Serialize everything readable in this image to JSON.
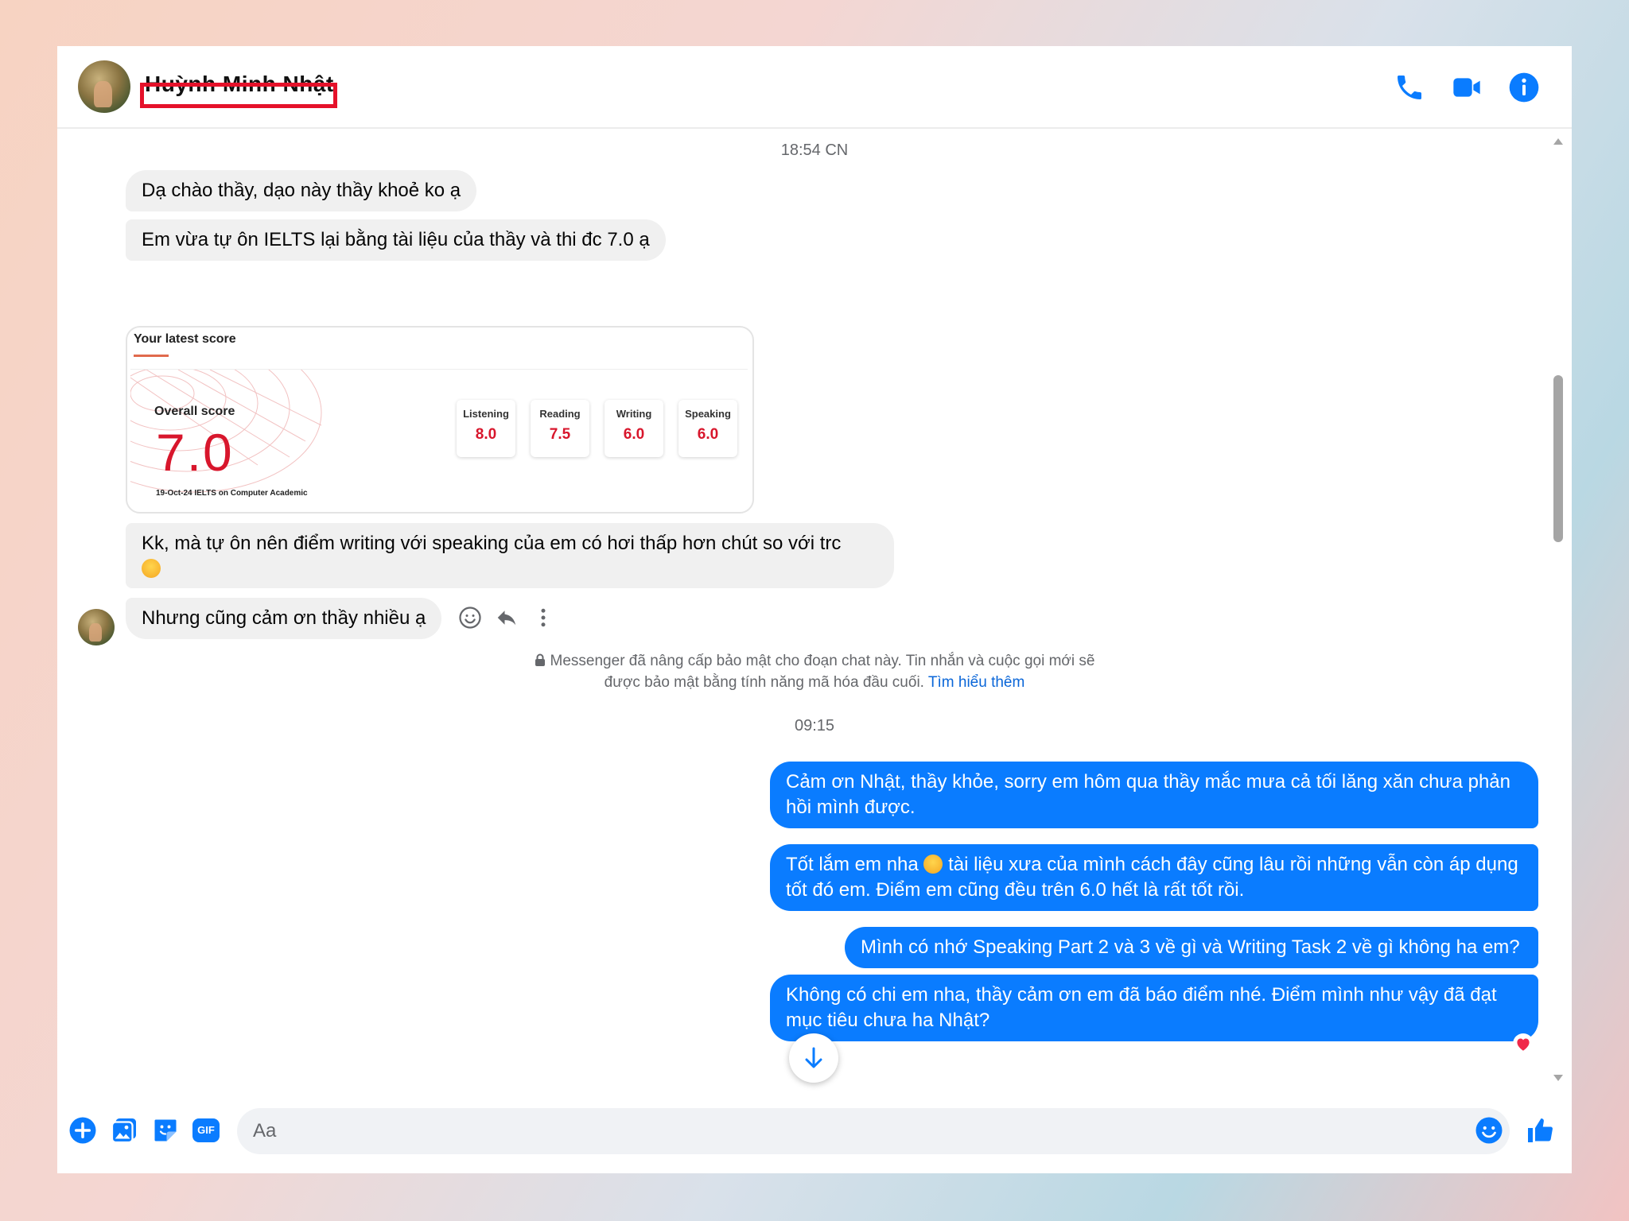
{
  "header": {
    "contact_name": "Huỳnh Minh Nhật",
    "icons": [
      "phone-icon",
      "video-call-icon",
      "info-icon"
    ]
  },
  "colors": {
    "accent": "#0a7cff",
    "incoming_bubble": "#f0f0f0",
    "score_red": "#d8162c",
    "redaction": "#e5112a"
  },
  "conversation": {
    "timestamp_1": "18:54 CN",
    "incoming": [
      "Dạ chào thầy, dạo này thầy khoẻ ko ạ",
      "Em vừa tự ôn IELTS lại bằng tài liệu của thầy và thi đc 7.0 ạ",
      "Kk, mà tự ôn nên điểm writing với speaking của em có hơi thấp hơn chút so với trc",
      "Nhưng cũng cảm ơn thầy nhiều ạ"
    ],
    "score_card": {
      "title": "Your latest score",
      "overall_label": "Overall score",
      "overall_value": "7.0",
      "subtitle": "19-Oct-24 IELTS on Computer Academic",
      "bands": [
        {
          "label": "Listening",
          "value": "8.0"
        },
        {
          "label": "Reading",
          "value": "7.5"
        },
        {
          "label": "Writing",
          "value": "6.0"
        },
        {
          "label": "Speaking",
          "value": "6.0"
        }
      ]
    },
    "encryption_notice": {
      "line1": "Messenger đã nâng cấp bảo mật cho đoạn chat này. Tin nhắn và cuộc gọi mới sẽ",
      "line2": "được bảo mật bằng tính năng mã hóa đầu cuối.",
      "link": "Tìm hiểu thêm"
    },
    "timestamp_2": "09:15",
    "outgoing": [
      "Cảm ơn Nhật, thầy khỏe, sorry em hôm qua thầy mắc mưa cả tối lăng xăn chưa phản hồi mình được.",
      "Tốt lắm em nha",
      "tài liệu xưa của mình cách đây cũng lâu rồi những vẫn còn áp dụng tốt đó em. Điểm em cũng đều trên 6.0 hết là rất tốt rồi.",
      "Mình có nhớ Speaking Part 2 và 3 về gì và Writing Task 2 về gì không ha em?",
      "Không có chi em nha, thầy cảm ơn em đã báo điểm nhé. Điểm mình như vậy đã đạt mục tiêu chưa ha Nhật?"
    ],
    "last_message_reaction": "heart"
  },
  "composer": {
    "placeholder": "Aa",
    "value": "",
    "gif_label": "GIF"
  }
}
